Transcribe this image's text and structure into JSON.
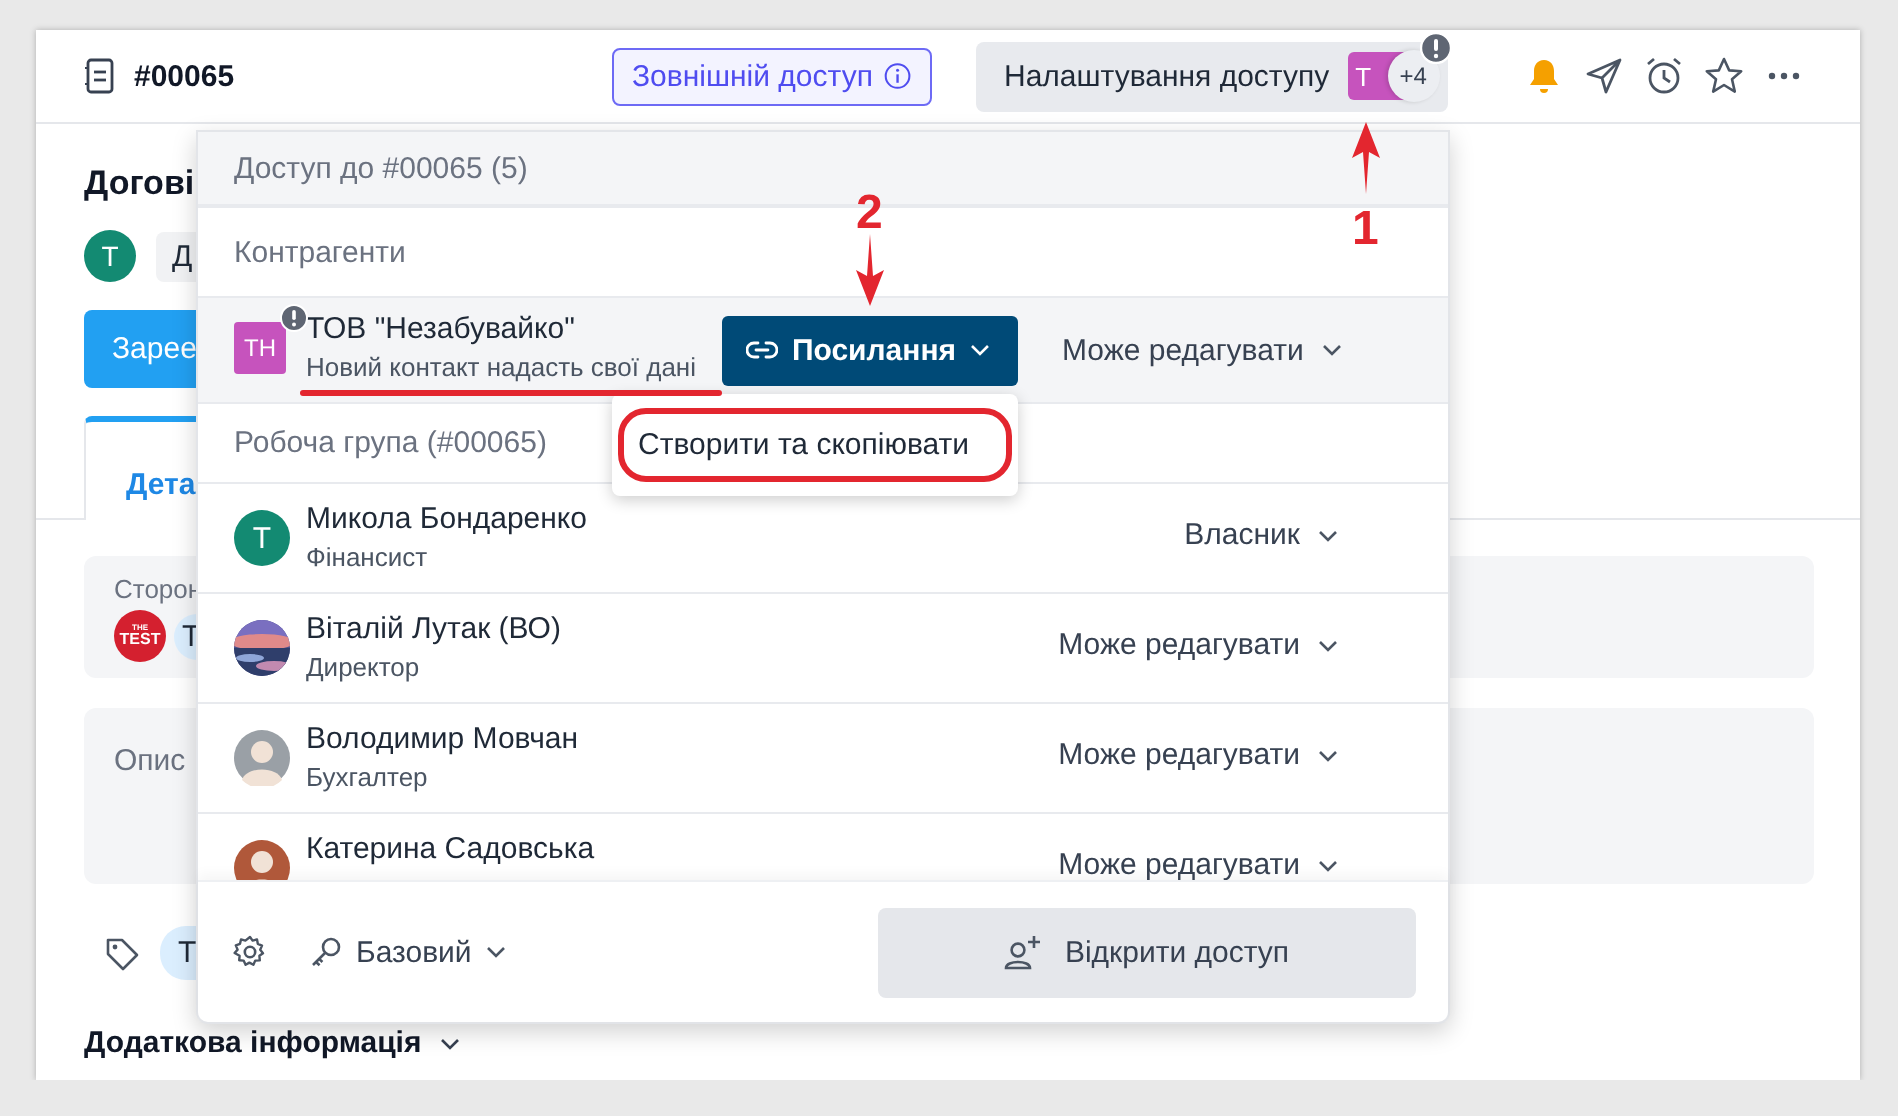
{
  "header": {
    "doc_number": "#00065",
    "external_access": {
      "label": "Зовнішній доступ"
    },
    "access_settings": {
      "label": "Налаштування доступу",
      "avatar_text": "Т",
      "extra_count": "+4",
      "alert": true
    },
    "actions": [
      {
        "kind": "bell",
        "active": true
      },
      {
        "kind": "send",
        "active": false
      },
      {
        "kind": "alarm",
        "active": false
      },
      {
        "kind": "star",
        "active": false
      },
      {
        "kind": "more",
        "active": false
      }
    ]
  },
  "document": {
    "title": "Догові",
    "author_avatar": "T",
    "status_chip": "Д",
    "primary_button": "Зарее",
    "tabs": [
      {
        "label": "Дета",
        "selected": true
      }
    ],
    "parties": {
      "label": "Сторон",
      "logo_top": "THE",
      "logo_main": "TEST",
      "chip": "Т"
    },
    "description": {
      "label": "Опис"
    },
    "tags": [
      {
        "label": "Т"
      }
    ],
    "additional": {
      "label": "Додаткова інформація",
      "expanded": false
    }
  },
  "popup": {
    "title": "Доступ до #00065 (5)",
    "sections": [
      {
        "title": "Контрагенти",
        "members": [
          {
            "avatar": {
              "kind": "company",
              "text": "ТН",
              "color": "#c653bd"
            },
            "alert": true,
            "highlighted": true,
            "name": "ТОВ \"Незабувайко\"",
            "subtitle": "Новий контакт надасть свої дані",
            "link_button": {
              "label": "Посилання"
            },
            "permission": "Може редагувати"
          }
        ]
      },
      {
        "title": "Робоча група (#00065)",
        "members": [
          {
            "avatar": {
              "kind": "initials",
              "text": "T",
              "color": "#138a72"
            },
            "alert": false,
            "highlighted": false,
            "name": "Микола Бондаренко",
            "subtitle": "Фінансист",
            "permission": "Власник"
          },
          {
            "alert": false,
            "highlighted": false,
            "name": "Віталій Лутак (ВО)",
            "subtitle": "Директор",
            "permission": "Може редагувати"
          },
          {
            "avatar": {
              "kind": "person",
              "color": "#9aa0a6"
            },
            "alert": false,
            "highlighted": false,
            "name": "Володимир Мовчан",
            "subtitle": "Бухгалтер",
            "permission": "Може редагувати"
          },
          {
            "avatar": {
              "kind": "person",
              "color": "#b0583a"
            },
            "alert": false,
            "highlighted": false,
            "name": "Катерина Садовська",
            "permission": "Може редагувати"
          }
        ]
      }
    ],
    "link_menu": {
      "items": [
        {
          "label": "Створити та скопіювати",
          "highlighted": true
        }
      ]
    },
    "footer": {
      "access_level": "Базовий",
      "share_button": "Відкрити доступ"
    }
  },
  "annotations": [
    {
      "label": "1"
    },
    {
      "label": "2"
    }
  ]
}
